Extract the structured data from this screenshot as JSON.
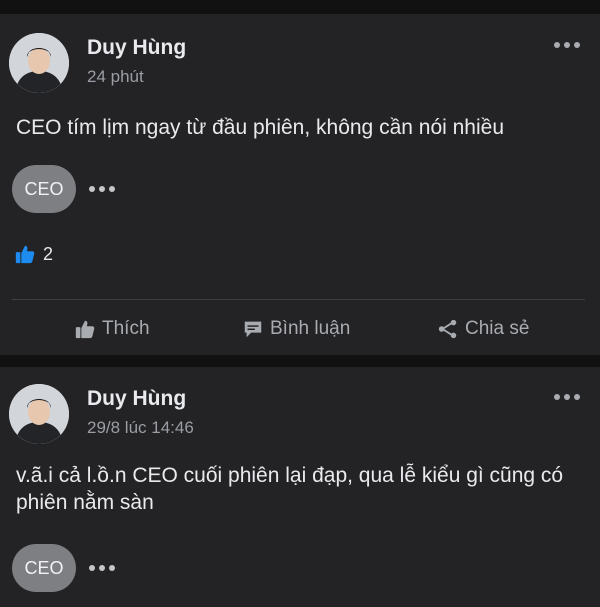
{
  "posts": [
    {
      "author": "Duy Hùng",
      "time": "24 phút",
      "text": "CEO tím lịm ngay từ đầu phiên, không cần nói nhiều",
      "tag": "CEO",
      "reaction_count": "2",
      "actions": {
        "like": "Thích",
        "comment": "Bình luận",
        "share": "Chia sẻ"
      }
    },
    {
      "author": "Duy Hùng",
      "time": "29/8 lúc 14:46",
      "text": "v.ã.i cả l.ồ.n CEO cuối phiên lại đạp, qua lễ kiểu gì cũng có phiên nằm sàn",
      "tag": "CEO"
    }
  ],
  "colors": {
    "background": "#111112",
    "card": "#232325",
    "like_blue": "#1d8bf0",
    "muted": "#a8abb0"
  },
  "icons": [
    "thumbs-up-icon",
    "comment-icon",
    "share-icon",
    "more-icon"
  ]
}
